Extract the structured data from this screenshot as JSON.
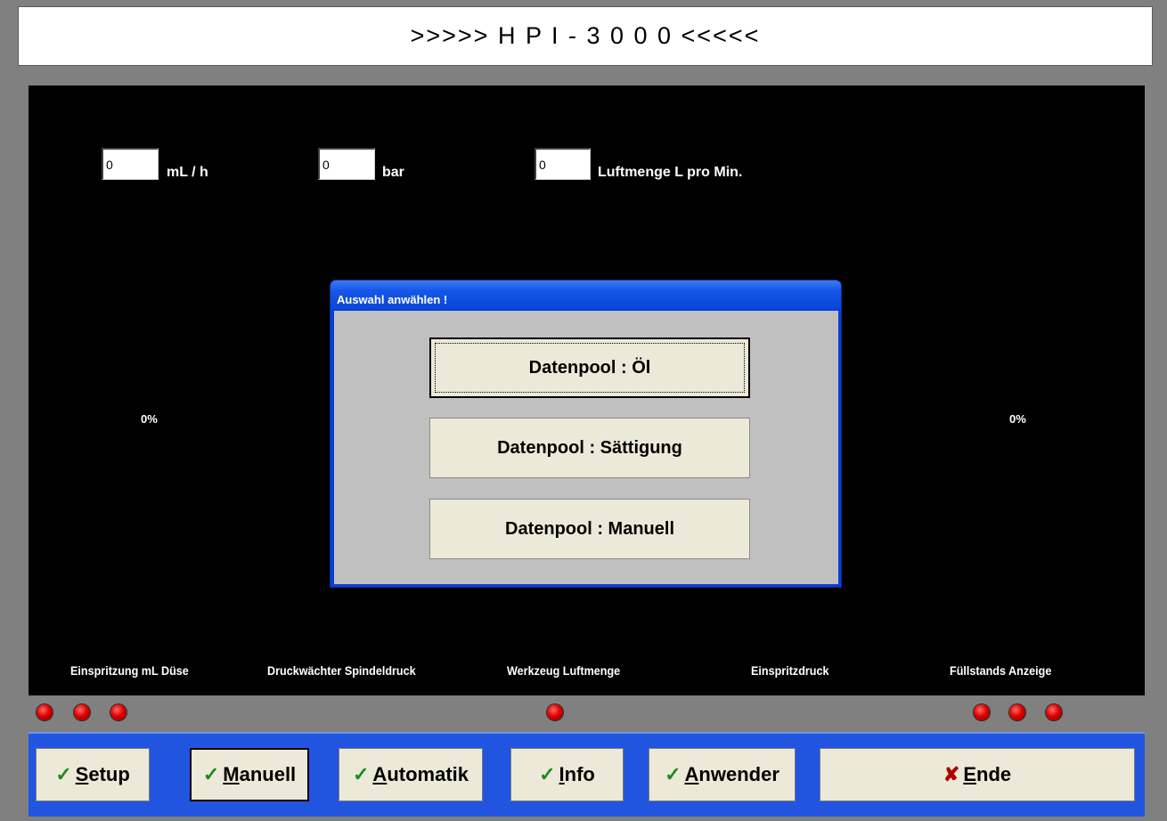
{
  "header": {
    "title": ">>>>> H P I - 3 0 0 0 <<<<<"
  },
  "inputs": [
    {
      "value": "0",
      "unit": "mL / h"
    },
    {
      "value": "0",
      "unit": "bar"
    },
    {
      "value": "0",
      "unit": "Luftmenge L pro Min."
    }
  ],
  "gauges": {
    "left_percent": "0%",
    "right_percent": "0%"
  },
  "labels": [
    "Einspritzung mL Düse",
    "Druckwächter Spindeldruck",
    "Werkzeug Luftmenge",
    "Einspritzdruck",
    "Füllstands Anzeige"
  ],
  "indicators": {
    "color": "#e00000",
    "state": "red"
  },
  "dialog": {
    "title": "Auswahl anwählen !",
    "buttons": [
      "Datenpool : Öl",
      "Datenpool : Sättigung",
      "Datenpool : Manuell"
    ]
  },
  "toolbar": {
    "buttons": [
      {
        "label": "Setup",
        "icon": "check-icon"
      },
      {
        "label": "Manuell",
        "icon": "check-icon"
      },
      {
        "label": "Automatik",
        "icon": "check-icon"
      },
      {
        "label": "Info",
        "icon": "check-icon"
      },
      {
        "label": "Anwender",
        "icon": "check-icon"
      },
      {
        "label": "Ende",
        "icon": "x-icon"
      }
    ]
  },
  "colors": {
    "panel": "#000000",
    "dialog_title": "#0a46d8",
    "toolbar": "#2155e0",
    "button": "#ece9d8"
  }
}
